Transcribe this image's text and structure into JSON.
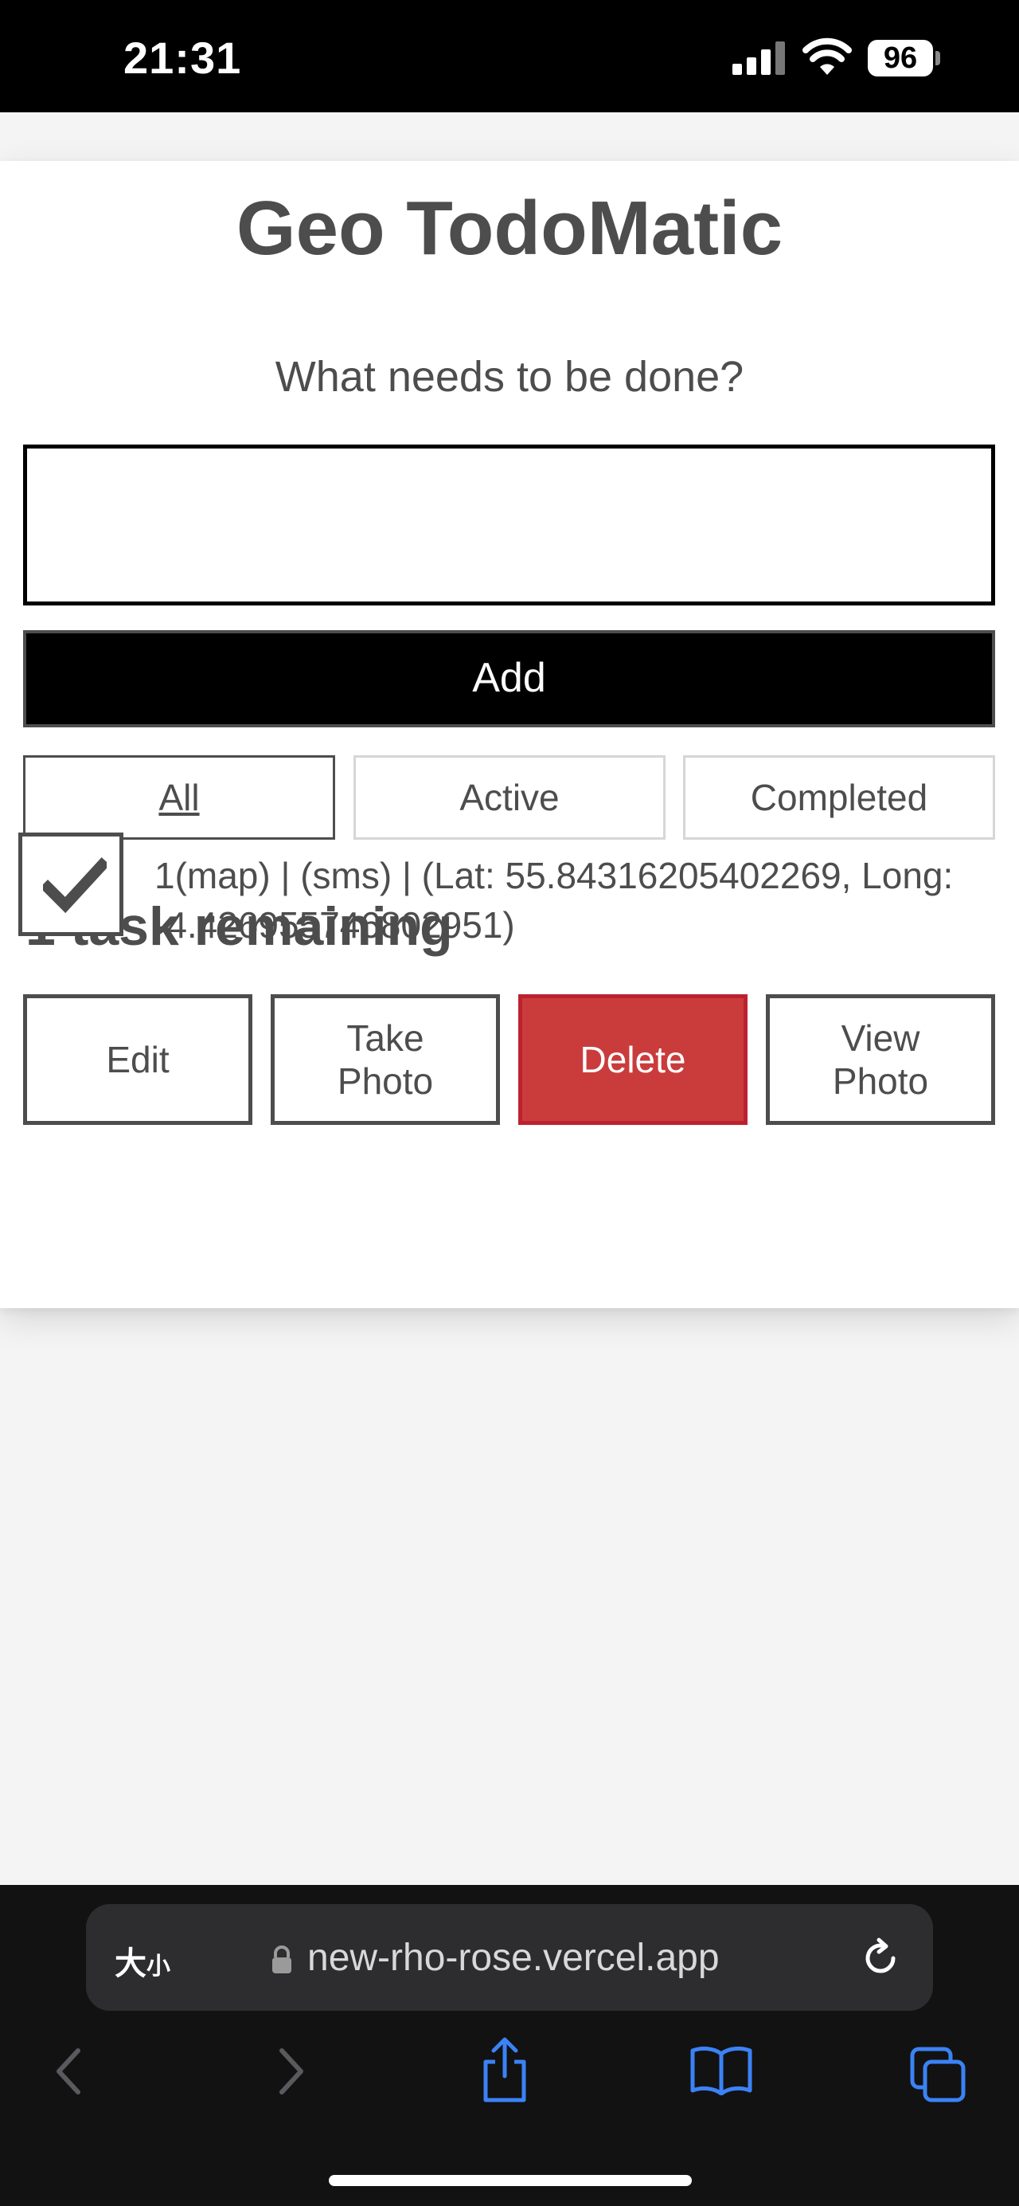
{
  "status_bar": {
    "time": "21:31",
    "battery": "96"
  },
  "app": {
    "title": "Geo TodoMatic",
    "new_todo_label": "What needs to be done?",
    "new_todo_value": "",
    "add_label": "Add"
  },
  "filters": [
    {
      "label": "All",
      "pressed": true
    },
    {
      "label": "Active",
      "pressed": false
    },
    {
      "label": "Completed",
      "pressed": false
    }
  ],
  "remaining_heading": "1 task remaining",
  "todos": [
    {
      "checked": true,
      "label": "1(map)  |  (sms)  |  (Lat: 55.84316205402269, Long: -4.426955746802951)",
      "buttons": {
        "edit": "Edit",
        "take_photo": "Take Photo",
        "delete": "Delete",
        "view_photo": "View Photo"
      }
    }
  ],
  "browser": {
    "text_size_label": "大",
    "text_size_small": "小",
    "url": "new-rho-rose.vercel.app",
    "icons": [
      "back-icon",
      "forward-icon",
      "share-icon",
      "bookmarks-icon",
      "tabs-icon",
      "reload-icon",
      "lock-icon"
    ]
  },
  "colors": {
    "delete_bg": "#ca3c3c",
    "add_bg": "#000000",
    "text": "#4d4d4d",
    "page_bg": "#f4f4f4",
    "browser_bg": "#121212",
    "ios_blue": "#3b82f6"
  }
}
